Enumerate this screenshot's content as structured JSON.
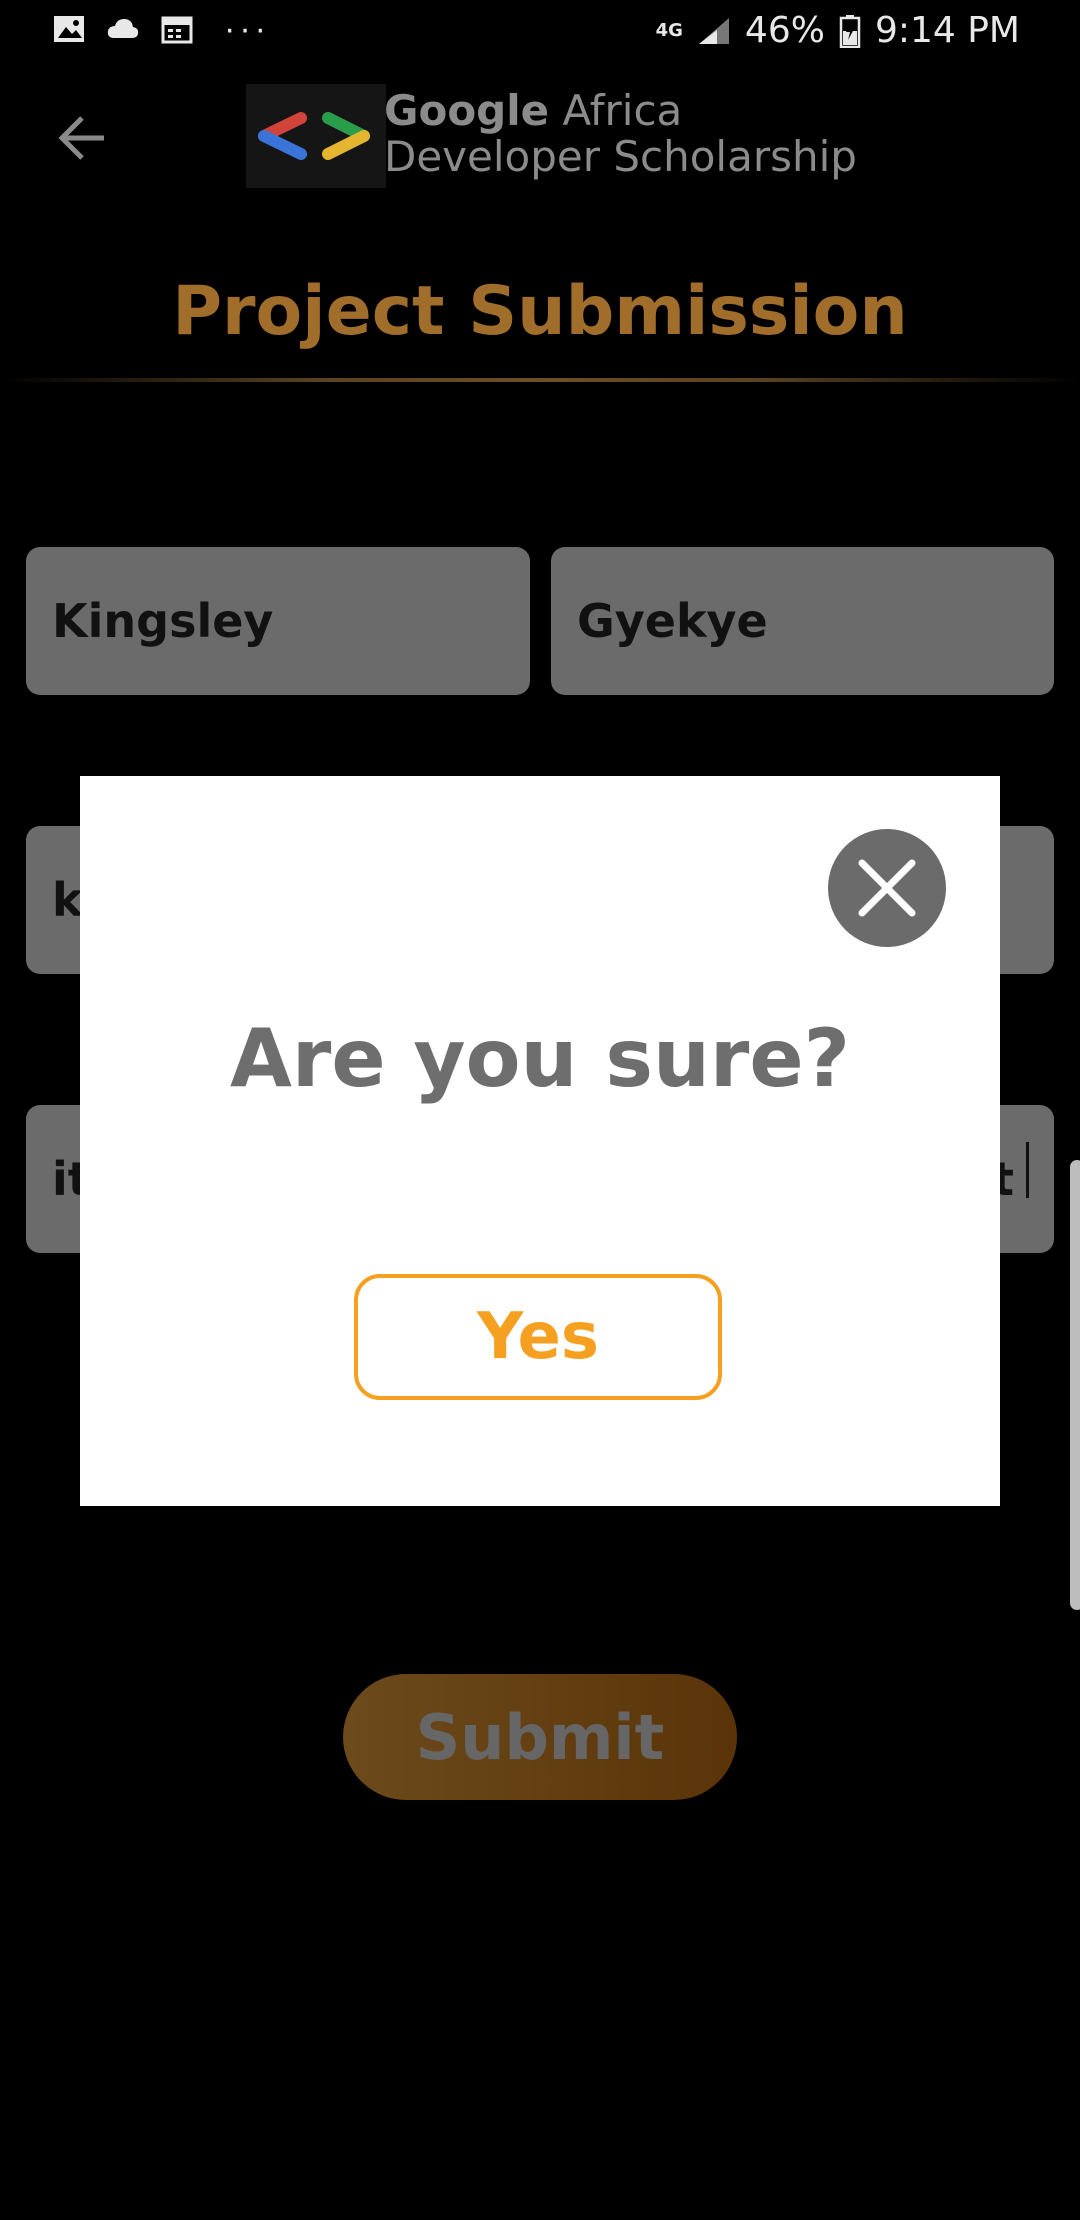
{
  "status_bar": {
    "network": "4G",
    "battery": "46%",
    "time": "9:14 PM",
    "more": "···",
    "icons": [
      "image-icon",
      "cloud-icon",
      "calendar-icon",
      "signal-icon",
      "battery-icon"
    ]
  },
  "app_bar": {
    "logo_bold": "Google",
    "logo_rest": " Africa",
    "logo_line2": "Developer Scholarship",
    "back_icon": "arrow-left-icon"
  },
  "page": {
    "title": "Project Submission"
  },
  "form": {
    "first_name": "Kingsley",
    "last_name": "Gyekye",
    "email_partial": "k",
    "link_partial_left": "it",
    "link_partial_right": "ct"
  },
  "submit": {
    "label": "Submit"
  },
  "dialog": {
    "title": "Are you sure?",
    "yes_label": "Yes",
    "close_icon": "close-icon"
  },
  "colors": {
    "accent": "#f5a020",
    "title_gold": "#a06d2b",
    "field_bg": "#6b6b6b"
  }
}
